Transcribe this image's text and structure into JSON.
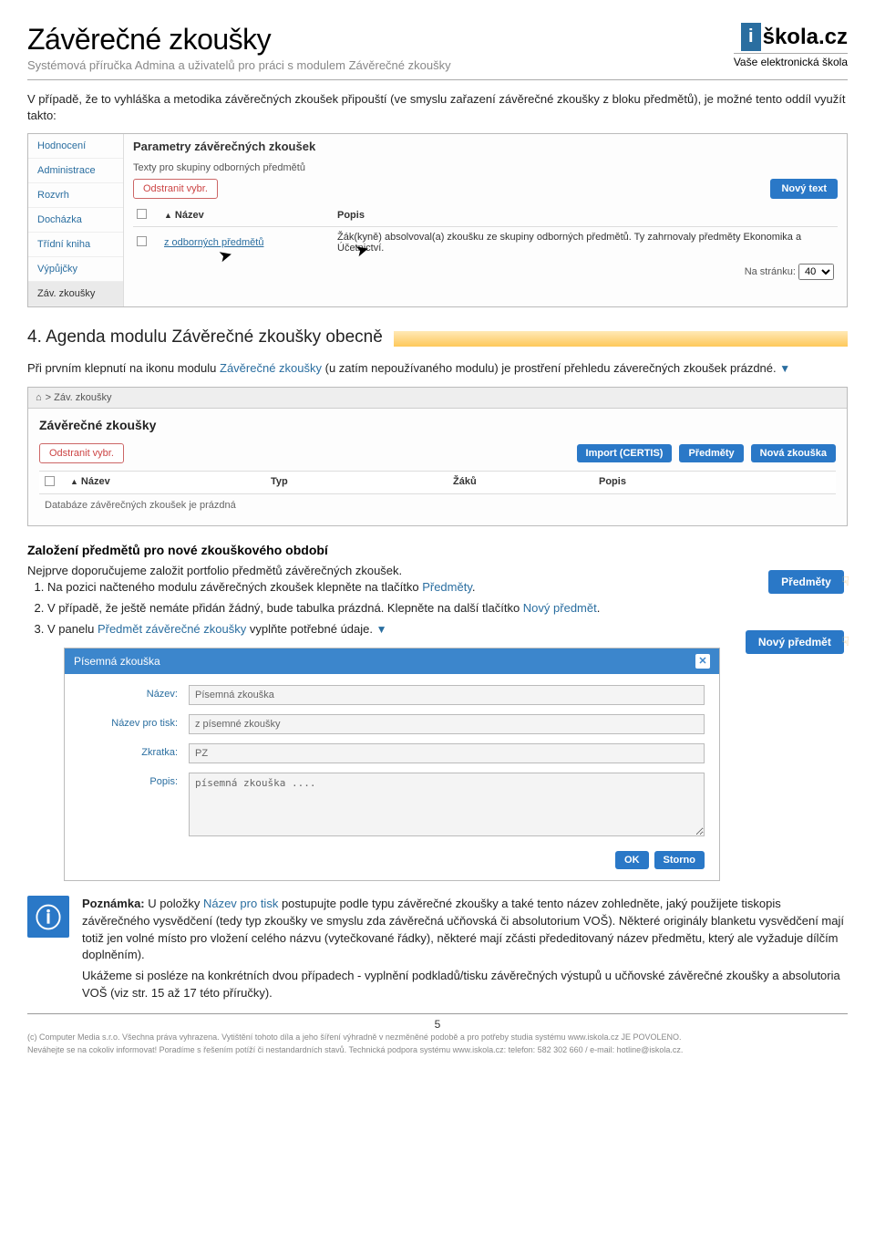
{
  "header": {
    "title": "Závěrečné zkoušky",
    "subtitle": "Systémová příručka Admina a uživatelů pro práci s modulem Závěrečné zkoušky",
    "logo_i": "i",
    "logo_text": "škola.cz",
    "tagline": "Vaše elektronická škola"
  },
  "intro_text": "V případě, že to vyhláška a metodika závěrečných zkoušek připouští (ve smyslu zařazení závěrečné zkoušky z bloku předmětů), je možné tento oddíl využít takto:",
  "shot1": {
    "sidebar": [
      "Hodnocení",
      "Administrace",
      "Rozvrh",
      "Docházka",
      "Třídní kniha",
      "Výpůjčky",
      "Záv. zkoušky"
    ],
    "sidebar_active_index": 6,
    "section_title": "Parametry závěrečných zkoušek",
    "sub_label": "Texty pro skupiny odborných předmětů",
    "btn_remove": "Odstranit vybr.",
    "btn_new": "Nový text",
    "col_name": "Název",
    "col_desc": "Popis",
    "row_name": "z odborných předmětů",
    "row_desc": "Žák(kyně) absolvoval(a) zkoušku ze skupiny odborných předmětů. Ty zahrnovaly předměty Ekonomika a Účetnictví.",
    "pager_label": "Na stránku:",
    "pager_value": "40"
  },
  "chapter": {
    "num": "4.",
    "title": "Agenda modulu Závěrečné zkoušky obecně",
    "para": "Při prvním klepnutí na ikonu modulu ",
    "para_link": "Závěrečné zkoušky",
    "para_rest": " (u zatím nepoužívaného modulu) je prostření přehledu záverečných zkoušek prázdné."
  },
  "shot2": {
    "breadcrumb": "> Záv. zkoušky",
    "title": "Závěrečné zkoušky",
    "btn_remove": "Odstranit vybr.",
    "btn_import": "Import (CERTIS)",
    "btn_subjects": "Předměty",
    "btn_new": "Nová zkouška",
    "col_name": "Název",
    "col_type": "Typ",
    "col_students": "Žáků",
    "col_desc": "Popis",
    "empty_msg": "Databáze závěrečných zkoušek je prázdná"
  },
  "block": {
    "h3": "Založení předmětů pro nové zkouškového období",
    "p1": "Nejprve doporučujeme založit portfolio předmětů závěrečných zkoušek.",
    "li1_a": "Na pozici načteného modulu závěrečných zkoušek klepněte na tlačítko ",
    "li1_b": "Předměty",
    "li1_c": ".",
    "li2_a": "V případě, že ještě nemáte přidán žádný, bude tabulka prázdná. Klepněte na další tlačítko ",
    "li2_b": "Nový předmět",
    "li2_c": ".",
    "li3_a": "V panelu ",
    "li3_b": "Předmět závěrečné zkoušky",
    "li3_c": " vyplňte potřebné údaje.",
    "float_btn1": "Předměty",
    "float_btn2": "Nový předmět"
  },
  "modal": {
    "title": "Písemná zkouška",
    "lbl_name": "Název:",
    "val_name": "Písemná zkouška",
    "lbl_print": "Název pro tisk:",
    "val_print": "z písemné zkoušky",
    "lbl_abbr": "Zkratka:",
    "val_abbr": "PZ",
    "lbl_desc": "Popis:",
    "val_desc": "písemná zkouška ....",
    "btn_ok": "OK",
    "btn_cancel": "Storno"
  },
  "info": {
    "para1_a": "Poznámka:",
    "para1_b": " U položky ",
    "para1_c": "Název pro tisk",
    "para1_d": " postupujte podle typu závěrečné zkoušky a také tento název zohledněte, jaký použijete tiskopis závěrečného vysvědčení (tedy typ zkoušky ve smyslu zda závěrečná učňovská či absolutorium VOŠ). Některé originály blanketu vysvědčení mají totiž jen volné místo pro vložení celého názvu (vytečkované řádky), některé mají zčásti přededitovaný název předmětu, který ale vyžaduje dílčím doplněním).",
    "para2": "Ukážeme si posléze na konkrétních dvou případech - vyplnění podkladů/tisku závěrečných výstupů u učňovské závěrečné zkoušky a absolutoria VOŠ (viz str. 15 až 17 této příručky)."
  },
  "page_num": "5",
  "footer": {
    "line1": "(c) Computer Media s.r.o. Všechna práva vyhrazena. Vytištění tohoto díla a jeho šíření výhradně v nezměněné podobě a pro potřeby studia systému www.iskola.cz JE POVOLENO.",
    "line2": "Neváhejte se na cokoliv informovat! Poradíme s řešením potíží či nestandardních stavů. Technická podpora systému www.iskola.cz: telefon: 582 302 660 / e-mail: hotline@iskola.cz."
  }
}
